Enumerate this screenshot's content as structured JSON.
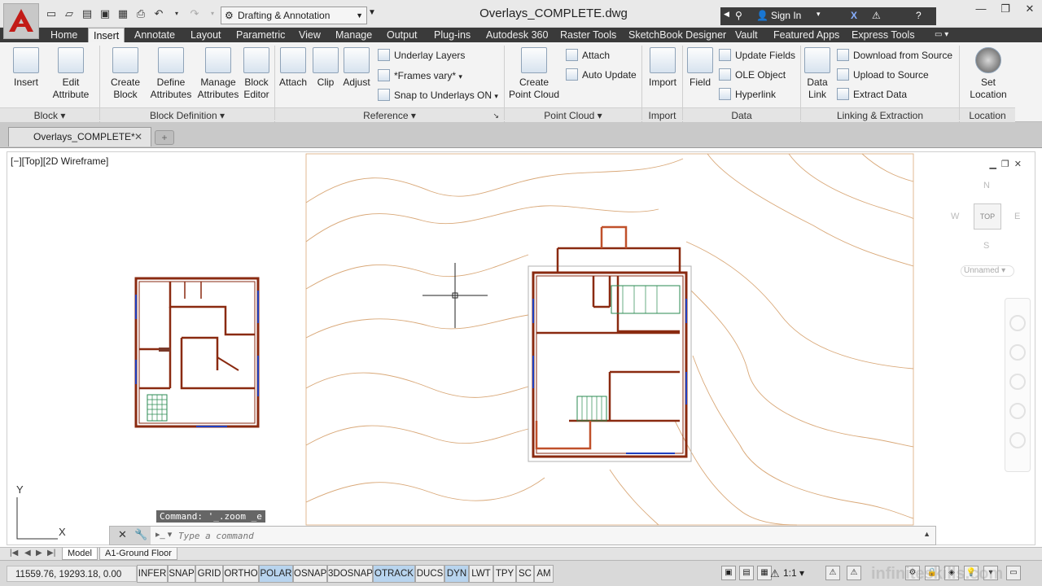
{
  "app": {
    "title": "Overlays_COMPLETE.dwg",
    "workspace": "Drafting & Annotation",
    "sign_in": "Sign In",
    "help": "?"
  },
  "ribbon_tabs": [
    "Home",
    "Insert",
    "Annotate",
    "Layout",
    "Parametric",
    "View",
    "Manage",
    "Output",
    "Plug-ins",
    "Autodesk 360",
    "Raster Tools",
    "SketchBook Designer",
    "Vault",
    "Featured Apps",
    "Express Tools"
  ],
  "ribbon": {
    "block": {
      "title": "Block",
      "insert": "Insert",
      "edit_attribute": [
        "Edit",
        "Attribute"
      ]
    },
    "block_definition": {
      "title": "Block Definition",
      "create_block": [
        "Create",
        "Block"
      ],
      "define_attributes": [
        "Define",
        "Attributes"
      ],
      "manage_attributes": [
        "Manage",
        "Attributes"
      ],
      "block_editor": [
        "Block",
        "Editor"
      ]
    },
    "reference": {
      "title": "Reference",
      "attach": "Attach",
      "clip": "Clip",
      "adjust": "Adjust",
      "underlay_layers": "Underlay Layers",
      "frames_vary": "*Frames vary*",
      "snap_to_underlays": "Snap to Underlays ON"
    },
    "point_cloud": {
      "title": "Point Cloud",
      "create_point_cloud": [
        "Create",
        "Point Cloud"
      ],
      "attach": "Attach",
      "auto_update": "Auto Update"
    },
    "import": {
      "title": "Import",
      "import": "Import"
    },
    "data": {
      "title": "Data",
      "field": "Field",
      "update_fields": "Update Fields",
      "ole_object": "OLE Object",
      "hyperlink": "Hyperlink"
    },
    "linking": {
      "title": "Linking & Extraction",
      "data_link": [
        "Data",
        "Link"
      ],
      "download_from_source": "Download from Source",
      "upload_to_source": "Upload to Source",
      "extract_data": "Extract  Data"
    },
    "location": {
      "title": "Location",
      "set_location": [
        "Set",
        "Location"
      ]
    }
  },
  "file_tab": "Overlays_COMPLETE*",
  "viewport": {
    "label": "[−][Top][2D Wireframe]",
    "viewcube": {
      "n": "N",
      "s": "S",
      "e": "E",
      "w": "W",
      "top": "TOP"
    },
    "ucs_name": "Unnamed",
    "ucs_x": "X",
    "ucs_y": "Y"
  },
  "command": {
    "history": "Command: '_.zoom _e",
    "placeholder": "Type a command"
  },
  "layout_tabs": [
    "Model",
    "A1-Ground Floor"
  ],
  "status": {
    "coords": "11559.76, 19293.18, 0.00",
    "toggles": [
      {
        "label": "INFER",
        "on": false
      },
      {
        "label": "SNAP",
        "on": false
      },
      {
        "label": "GRID",
        "on": false
      },
      {
        "label": "ORTHO",
        "on": false
      },
      {
        "label": "POLAR",
        "on": true
      },
      {
        "label": "OSNAP",
        "on": false
      },
      {
        "label": "3DOSNAP",
        "on": false
      },
      {
        "label": "OTRACK",
        "on": true
      },
      {
        "label": "DUCS",
        "on": false
      },
      {
        "label": "DYN",
        "on": true
      },
      {
        "label": "LWT",
        "on": false
      },
      {
        "label": "TPY",
        "on": false
      },
      {
        "label": "SC",
        "on": false
      },
      {
        "label": "AM",
        "on": false
      }
    ],
    "scale": "1:1"
  },
  "watermark": "infiniteskills.com",
  "colors": {
    "contour": "#d9a878",
    "wall": "#8a2a10",
    "wall_light": "#c0502a",
    "window": "#2040c0",
    "stair": "#2a8a50",
    "accent": "#b8d4ee"
  }
}
